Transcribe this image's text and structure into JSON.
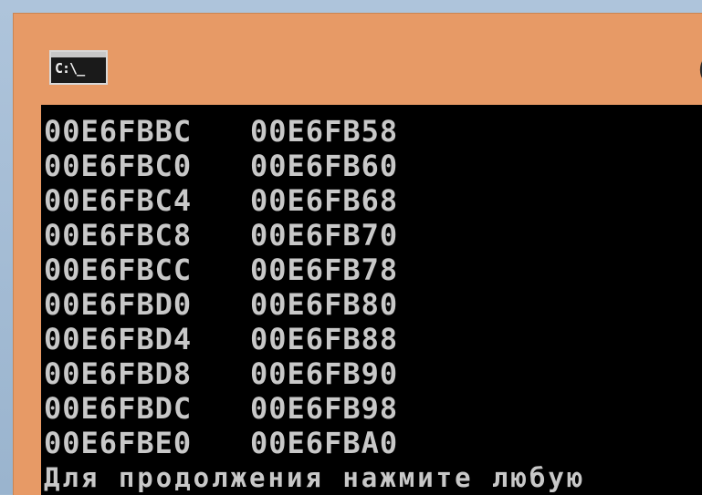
{
  "window": {
    "icon_text": "C:\\_",
    "title_edge_glyph": "("
  },
  "console": {
    "rows": [
      [
        "00E6FBBC",
        "00E6FB58"
      ],
      [
        "00E6FBC0",
        "00E6FB60"
      ],
      [
        "00E6FBC4",
        "00E6FB68"
      ],
      [
        "00E6FBC8",
        "00E6FB70"
      ],
      [
        "00E6FBCC",
        "00E6FB78"
      ],
      [
        "00E6FBD0",
        "00E6FB80"
      ],
      [
        "00E6FBD4",
        "00E6FB88"
      ],
      [
        "00E6FBD8",
        "00E6FB90"
      ],
      [
        "00E6FBDC",
        "00E6FB98"
      ],
      [
        "00E6FBE0",
        "00E6FBA0"
      ]
    ],
    "prompt": "Для продолжения нажмите любую"
  },
  "colors": {
    "window_frame": "#e79a66",
    "console_bg": "#000000",
    "console_text": "#c8c8c8",
    "desktop": "#9fb8d0"
  }
}
